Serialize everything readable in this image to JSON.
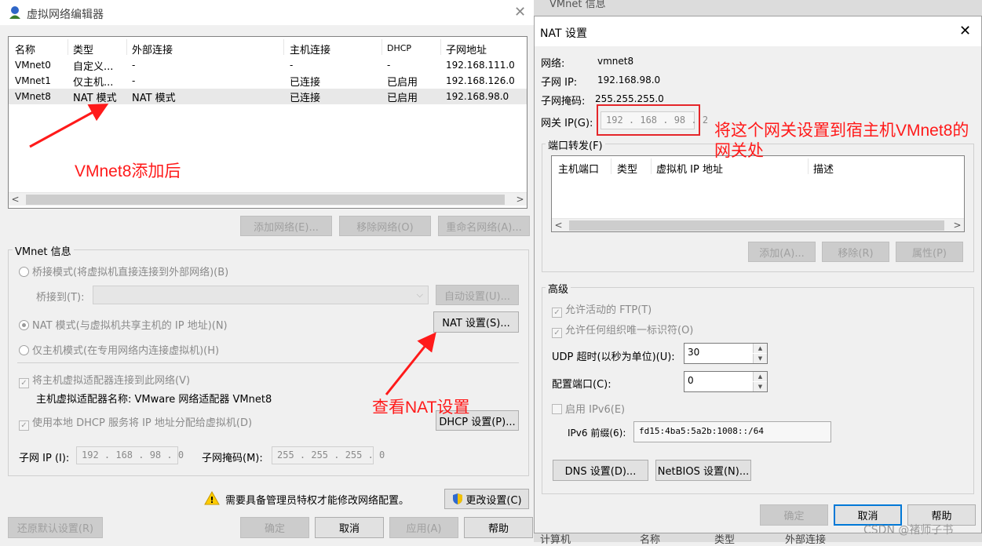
{
  "left": {
    "title": "虚拟网络编辑器",
    "table": {
      "headers": [
        "名称",
        "类型",
        "外部连接",
        "主机连接",
        "DHCP",
        "子网地址"
      ],
      "rows": [
        [
          "VMnet0",
          "自定义...",
          "-",
          "-",
          "-",
          "192.168.111.0"
        ],
        [
          "VMnet1",
          "仅主机...",
          "-",
          "已连接",
          "已启用",
          "192.168.126.0"
        ],
        [
          "VMnet8",
          "NAT 模式",
          "NAT 模式",
          "已连接",
          "已启用",
          "192.168.98.0"
        ]
      ]
    },
    "buttons": {
      "add_network": "添加网络(E)...",
      "remove_network": "移除网络(O)",
      "rename_network": "重命名网络(A)..."
    },
    "vmnet_info": {
      "group_label": "VMnet 信息",
      "bridge_mode": "桥接模式(将虚拟机直接连接到外部网络)(B)",
      "bridge_to": "桥接到(T):",
      "auto_setting": "自动设置(U)...",
      "nat_mode": "NAT 模式(与虚拟机共享主机的 IP 地址)(N)",
      "nat_settings": "NAT 设置(S)...",
      "host_only": "仅主机模式(在专用网络内连接虚拟机)(H)",
      "connect_adapter": "将主机虚拟适配器连接到此网络(V)",
      "adapter_name": "主机虚拟适配器名称: VMware 网络适配器 VMnet8",
      "use_dhcp": "使用本地 DHCP 服务将 IP 地址分配给虚拟机(D)",
      "dhcp_settings": "DHCP 设置(P)...",
      "subnet_ip_label": "子网 IP (I):",
      "subnet_ip_value": "192 . 168 . 98 . 0",
      "subnet_mask_label": "子网掩码(M):",
      "subnet_mask_value": "255 . 255 . 255 . 0"
    },
    "admin_notice": "需要具备管理员特权才能修改网络配置。",
    "change_settings": "更改设置(C)",
    "restore_defaults": "还原默认设置(R)",
    "ok": "确定",
    "cancel": "取消",
    "apply": "应用(A)",
    "help": "帮助"
  },
  "right": {
    "title": "NAT 设置",
    "behind_title": "VMnet 信息",
    "network_label": "网络:",
    "network_value": "vmnet8",
    "subnet_ip_label": "子网 IP:",
    "subnet_ip_value": "192.168.98.0",
    "subnet_mask_label": "子网掩码:",
    "subnet_mask_value": "255.255.255.0",
    "gateway_label": "网关 IP(G):",
    "gateway_value": "192 . 168 . 98 .  2",
    "port_forward_label": "端口转发(F)",
    "port_headers": [
      "主机端口",
      "类型",
      "虚拟机 IP 地址",
      "描述"
    ],
    "add": "添加(A)...",
    "remove": "移除(R)",
    "properties": "属性(P)",
    "advanced_label": "高级",
    "allow_ftp": "允许活动的 FTP(T)",
    "allow_oui": "允许任何组织唯一标识符(O)",
    "udp_timeout_label": "UDP 超时(以秒为单位)(U):",
    "udp_timeout_value": "30",
    "config_port_label": "配置端口(C):",
    "config_port_value": "0",
    "enable_ipv6": "启用 IPv6(E)",
    "ipv6_prefix_label": "IPv6 前缀(6):",
    "ipv6_prefix_value": "fd15:4ba5:5a2b:1008::/64",
    "dns_settings": "DNS 设置(D)...",
    "netbios_settings": "NetBIOS 设置(N)...",
    "ok": "确定",
    "cancel": "取消",
    "help": "帮助",
    "bottom_bg": [
      "计算机",
      "名称",
      "类型",
      "外部连接"
    ]
  },
  "annotations": {
    "vmnet8_added": "VMnet8添加后",
    "view_nat": "查看NAT设置",
    "gateway_note": "将这个网关设置到宿主机VMnet8的网关处"
  },
  "watermark": "CSDN @褚师子书",
  "colors": {
    "annotation": "#ff1a1a",
    "accent": "#0078d7"
  }
}
